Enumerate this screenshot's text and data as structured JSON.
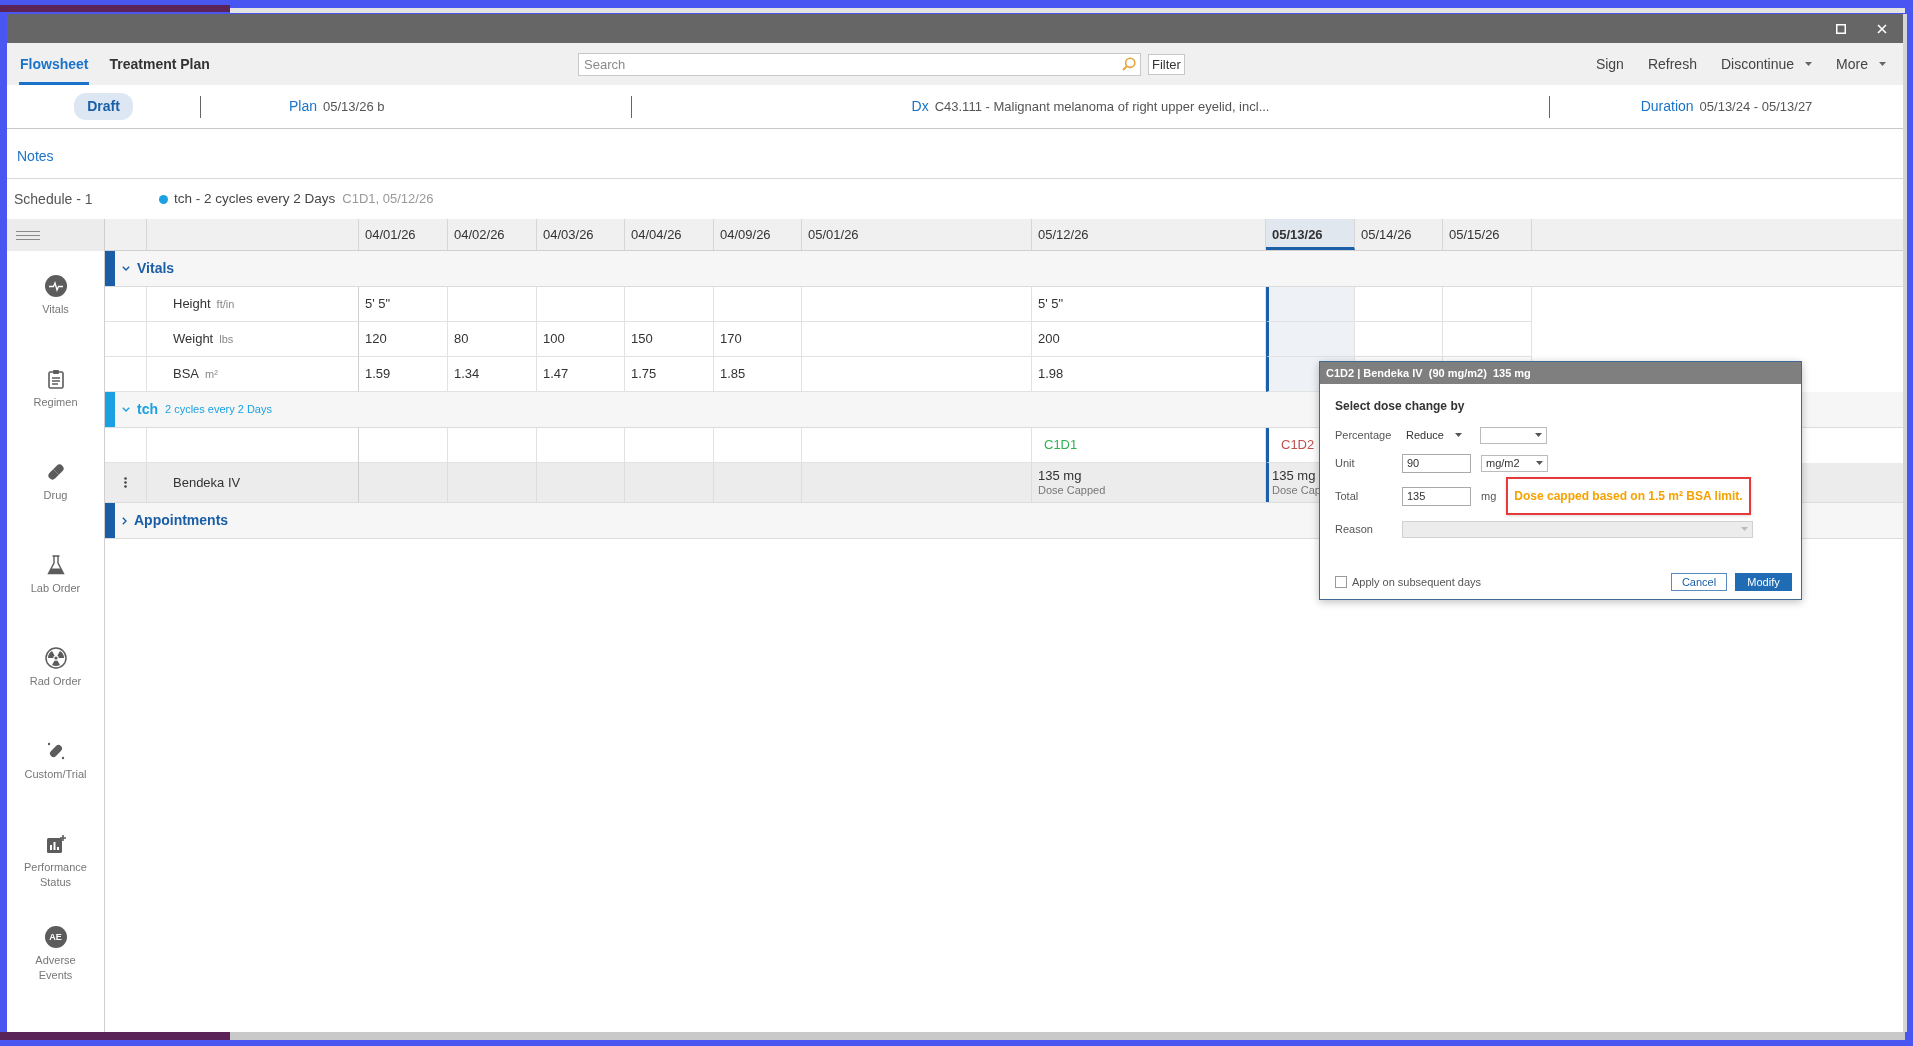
{
  "tabs": [
    {
      "label": "Flowsheet",
      "selected": true
    },
    {
      "label": "Treatment Plan",
      "selected": false
    }
  ],
  "search": {
    "placeholder": "Search"
  },
  "filter_button": "Filter",
  "actions": [
    {
      "label": "Sign",
      "kind": "button"
    },
    {
      "label": "Refresh",
      "kind": "button"
    },
    {
      "label": "Discontinue",
      "kind": "dropdown"
    },
    {
      "label": "More",
      "kind": "dropdown"
    }
  ],
  "plan_bar": {
    "status": "Draft",
    "fields": [
      {
        "label": "Plan",
        "value": "05/13/26 b"
      },
      {
        "label": "Dx",
        "value": "C43.111 - Malignant melanoma of right upper eyelid, incl..."
      },
      {
        "label": "Duration",
        "value": "05/13/24 - 05/13/27"
      }
    ]
  },
  "notes_link": "Notes",
  "schedule": {
    "label": "Schedule - 1",
    "regimens": [
      {
        "name": "tch - 2 cycles every 2 Days",
        "detail": "C1D1, 05/12/26",
        "color": "#1ba1e2"
      }
    ]
  },
  "sidebar": {
    "items": [
      {
        "label": "Vitals"
      },
      {
        "label": "Regimen"
      },
      {
        "label": "Drug"
      },
      {
        "label": "Lab Order"
      },
      {
        "label": "Rad Order"
      },
      {
        "label": "Custom/Trial"
      },
      {
        "label": "Performance Status"
      },
      {
        "label": "Adverse Events",
        "badge": "AE"
      }
    ]
  },
  "flowsheet": {
    "columns": [
      {
        "date": "04/01/26",
        "selected": false
      },
      {
        "date": "04/02/26",
        "selected": false
      },
      {
        "date": "04/03/26",
        "selected": false
      },
      {
        "date": "04/04/26",
        "selected": false
      },
      {
        "date": "04/09/26",
        "selected": false
      },
      {
        "date": "05/01/26",
        "selected": false
      },
      {
        "date": "05/12/26",
        "selected": false
      },
      {
        "date": "05/13/26",
        "selected": true
      },
      {
        "date": "05/14/26",
        "selected": false
      },
      {
        "date": "05/15/26",
        "selected": false
      }
    ],
    "sections": [
      {
        "title": "Vitals",
        "expanded": true,
        "color": "#1b5ea6",
        "rows": [
          {
            "kind": "vital",
            "label": "Height",
            "unit": "ft/in",
            "cells": [
              "5' 5\"",
              null,
              null,
              null,
              null,
              null,
              "5' 5\"",
              null,
              null,
              null
            ]
          },
          {
            "kind": "vital",
            "label": "Weight",
            "unit": "lbs",
            "cells": [
              "120",
              "80",
              "100",
              "150",
              "170",
              null,
              "200",
              null,
              null,
              null
            ]
          },
          {
            "kind": "vital",
            "label": "BSA",
            "unit": "m²",
            "cells": [
              "1.59",
              "1.34",
              "1.47",
              "1.75",
              "1.85",
              null,
              "1.98",
              null,
              null,
              null
            ]
          }
        ]
      },
      {
        "title": "tch",
        "subtitle": "2 cycles every 2 Days",
        "expanded": true,
        "color": "#1ba1e2",
        "rows": [
          {
            "kind": "cycle",
            "cells": [
              null,
              null,
              null,
              null,
              null,
              null,
              {
                "label": "C1D1",
                "color": "#2eb24f"
              },
              {
                "label": "C1D2",
                "color": "#c0504d"
              },
              null,
              null
            ]
          },
          {
            "kind": "drug",
            "label": "Bendeka IV",
            "cells": [
              null,
              null,
              null,
              null,
              null,
              null,
              {
                "dose": "135 mg",
                "note": "Dose Capped"
              },
              {
                "dose": "135 mg",
                "note": "Dose Cap"
              },
              null,
              null
            ]
          }
        ]
      },
      {
        "title": "Appointments",
        "expanded": false,
        "color": "#1b5ea6"
      }
    ]
  },
  "dialog": {
    "title": "C1D2 | Bendeka IV  (90 mg/m2)  135 mg",
    "heading": "Select dose change by",
    "fields": [
      {
        "kind": "percentage",
        "label": "Percentage",
        "mode": "Reduce"
      },
      {
        "kind": "amount",
        "label": "Unit",
        "value": "90",
        "unit": "mg/m2"
      },
      {
        "kind": "total",
        "label": "Total",
        "value": "135",
        "unit": "mg",
        "warning": "Dose capped based on 1.5 m² BSA limit."
      },
      {
        "kind": "reason",
        "label": "Reason",
        "disabled": true
      }
    ],
    "apply_option": {
      "label": "Apply on subsequent days",
      "checked": false
    },
    "buttons": [
      {
        "label": "Cancel",
        "kind": "secondary"
      },
      {
        "label": "Modify",
        "kind": "primary"
      }
    ]
  }
}
